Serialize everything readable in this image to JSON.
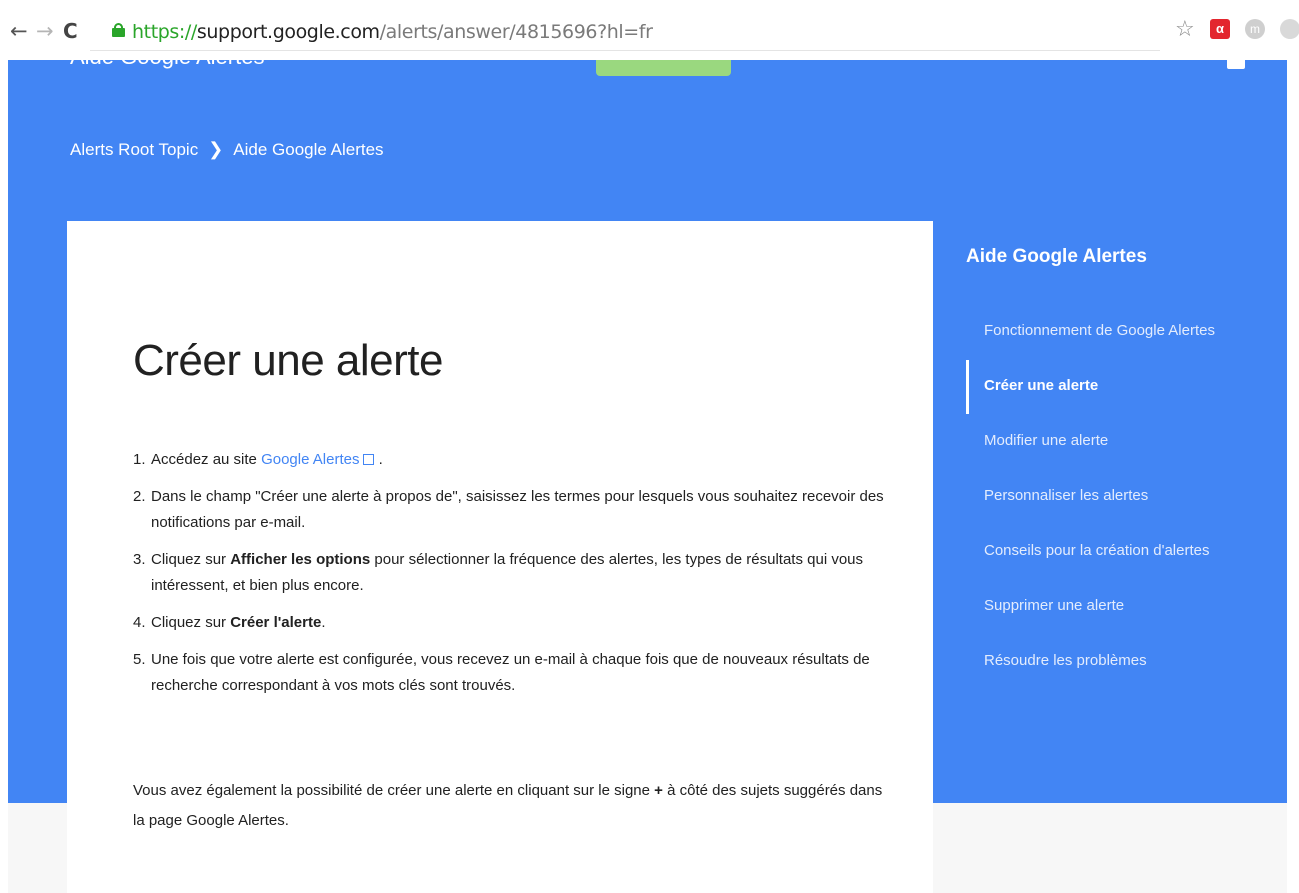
{
  "browser": {
    "url_scheme": "https://",
    "url_host": "support.google.com",
    "url_path": "/alerts/answer/4815696?hl=fr",
    "ext_red_label": "α",
    "ext_m_label": "m"
  },
  "header": {
    "site_title": "Aide Google Alertes",
    "breadcrumb": [
      "Alerts Root Topic",
      "Aide Google Alertes"
    ],
    "breadcrumb_sep": "❯"
  },
  "article": {
    "title": "Créer une alerte",
    "steps": [
      {
        "num": "1.",
        "before": "Accédez au site ",
        "link": "Google Alertes",
        "after": " ."
      },
      {
        "num": "2.",
        "text": "Dans le champ \"Créer une alerte à propos de\", saisissez les termes pour lesquels vous souhaitez recevoir des notifications par e-mail."
      },
      {
        "num": "3.",
        "before": "Cliquez sur ",
        "bold": "Afficher les options",
        "after": " pour sélectionner la fréquence des alertes, les types de résultats qui vous intéressent, et bien plus encore."
      },
      {
        "num": "4.",
        "before": "Cliquez sur ",
        "bold": "Créer l'alerte",
        "after": "."
      },
      {
        "num": "5.",
        "text": "Une fois que votre alerte est configurée, vous recevez un e-mail à chaque fois que de nouveaux résultats de recherche correspondant à vos mots clés sont trouvés."
      }
    ],
    "after_before": "Vous avez également la possibilité de créer une alerte en cliquant sur le signe ",
    "after_bold": "+",
    "after_after": " à côté des sujets suggérés dans la page Google Alertes."
  },
  "sidebar": {
    "title": "Aide Google Alertes",
    "items": [
      {
        "label": "Fonctionnement de Google Alertes"
      },
      {
        "label": "Créer une alerte"
      },
      {
        "label": "Modifier une alerte"
      },
      {
        "label": "Personnaliser les alertes"
      },
      {
        "label": "Conseils pour la création d'alertes"
      },
      {
        "label": "Supprimer une alerte"
      },
      {
        "label": "Résoudre les problèmes"
      }
    ]
  },
  "colors": {
    "brand_blue": "#4285f4",
    "secure_green": "#2aa52a"
  },
  "icons": [
    "back-arrow-icon",
    "forward-arrow-icon",
    "reload-icon",
    "lock-icon",
    "star-icon",
    "external-link-icon",
    "chevron-right-icon"
  ]
}
